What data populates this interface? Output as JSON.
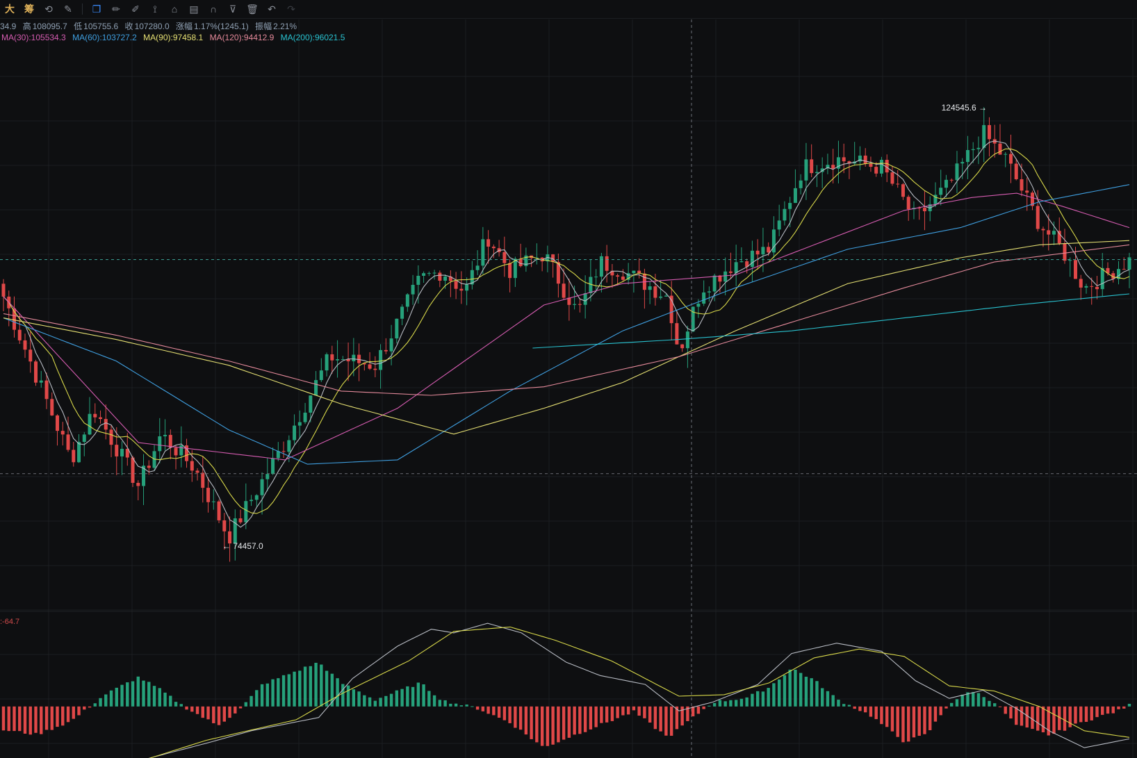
{
  "toolbar": {
    "tools": [
      {
        "name": "partial-left-tool",
        "glyph": "大"
      },
      {
        "name": "chip-distribution-tool",
        "glyph": "筹"
      },
      {
        "name": "refresh-chart-tool",
        "glyph": "⟲"
      },
      {
        "name": "pen-settings-tool",
        "glyph": "✎"
      },
      {
        "name": "copy-layout-tool",
        "glyph": "❐"
      },
      {
        "name": "ruler-tool",
        "glyph": "✏"
      },
      {
        "name": "brush-tool",
        "glyph": "✐"
      },
      {
        "name": "indicator-tool",
        "glyph": "⟟"
      },
      {
        "name": "lock-tool",
        "glyph": "⌂"
      },
      {
        "name": "note-tool",
        "glyph": "▤"
      },
      {
        "name": "magnet-tool",
        "glyph": "∩"
      },
      {
        "name": "filter-tool",
        "glyph": "⊽"
      },
      {
        "name": "delete-tool",
        "glyph": "🗑"
      },
      {
        "name": "undo-tool",
        "glyph": "↶"
      },
      {
        "name": "redo-tool",
        "glyph": "↷"
      }
    ]
  },
  "ohlc": {
    "open": "34.9",
    "high_label": "高",
    "high": "108095.7",
    "low_label": "低",
    "low": "105755.6",
    "close_label": "收",
    "close": "107280.0",
    "change_label": "涨幅",
    "change": "1.17%(1245.1)",
    "amp_label": "振幅",
    "amp": "2.21%"
  },
  "ma": [
    {
      "label": "MA(30):105534.3",
      "color": "#d65cb1"
    },
    {
      "label": "MA(60):103727.2",
      "color": "#3f9fe0"
    },
    {
      "label": "MA(90):97458.1",
      "color": "#e6e073"
    },
    {
      "label": "MA(120):94412.9",
      "color": "#e58a9b"
    },
    {
      "label": "MA(200):96021.5",
      "color": "#29c3d1"
    }
  ],
  "macd_label": ":-64.7",
  "colors": {
    "up": "#26a17b",
    "down": "#e04848",
    "grid": "#1b1d21",
    "crosshair": "#6b6f76",
    "ma5": "#b8bcc4",
    "ma10": "#d8d84a"
  },
  "chart_data": {
    "type": "candlestick",
    "y_range": [
      68000,
      131000
    ],
    "annotations": {
      "high": {
        "value": 124545.6,
        "text": "124545.6"
      },
      "low": {
        "value": 74457.0,
        "text": "74457.0"
      }
    },
    "crosshair_price": 107280.0,
    "lower_dashed_price": 82400,
    "anchors": [
      [
        103000,
        0
      ],
      [
        84000,
        0.06
      ],
      [
        90000,
        0.08
      ],
      [
        81000,
        0.12
      ],
      [
        87000,
        0.14
      ],
      [
        83000,
        0.17
      ],
      [
        75000,
        0.2
      ],
      [
        86000,
        0.25
      ],
      [
        96000,
        0.29
      ],
      [
        95000,
        0.33
      ],
      [
        105000,
        0.37
      ],
      [
        106000,
        0.39
      ],
      [
        103500,
        0.41
      ],
      [
        110000,
        0.43
      ],
      [
        106000,
        0.45
      ],
      [
        108000,
        0.48
      ],
      [
        101000,
        0.51
      ],
      [
        107000,
        0.53
      ],
      [
        106000,
        0.55
      ],
      [
        103000,
        0.59
      ],
      [
        96500,
        0.6
      ],
      [
        104000,
        0.62
      ],
      [
        107000,
        0.65
      ],
      [
        108500,
        0.68
      ],
      [
        118000,
        0.71
      ],
      [
        119000,
        0.74
      ],
      [
        118000,
        0.78
      ],
      [
        112000,
        0.81
      ],
      [
        116000,
        0.84
      ],
      [
        122000,
        0.87
      ],
      [
        119000,
        0.89
      ],
      [
        111500,
        0.92
      ],
      [
        108500,
        0.94
      ],
      [
        104000,
        0.96
      ],
      [
        107200,
        1
      ]
    ],
    "mas": [
      {
        "name": "MA(30)",
        "color": "#d65cb1",
        "values": [
          [
            0.0,
            103000
          ],
          [
            0.12,
            86000
          ],
          [
            0.25,
            84000
          ],
          [
            0.35,
            90000
          ],
          [
            0.48,
            102000
          ],
          [
            0.55,
            104500
          ],
          [
            0.65,
            105500
          ],
          [
            0.72,
            109000
          ],
          [
            0.8,
            113000
          ],
          [
            0.86,
            114500
          ],
          [
            0.9,
            115000
          ],
          [
            0.94,
            113500
          ],
          [
            1.0,
            111000
          ]
        ]
      },
      {
        "name": "MA(60)",
        "color": "#3f9fe0",
        "values": [
          [
            0.0,
            100500
          ],
          [
            0.1,
            95500
          ],
          [
            0.2,
            87500
          ],
          [
            0.27,
            83500
          ],
          [
            0.35,
            84000
          ],
          [
            0.45,
            92000
          ],
          [
            0.55,
            99000
          ],
          [
            0.65,
            104000
          ],
          [
            0.75,
            108500
          ],
          [
            0.85,
            111000
          ],
          [
            0.92,
            114000
          ],
          [
            1.0,
            116000
          ]
        ]
      },
      {
        "name": "MA(90)",
        "color": "#e6e073",
        "values": [
          [
            0.0,
            100500
          ],
          [
            0.1,
            98000
          ],
          [
            0.2,
            95000
          ],
          [
            0.3,
            90500
          ],
          [
            0.4,
            87000
          ],
          [
            0.48,
            90000
          ],
          [
            0.55,
            93000
          ],
          [
            0.65,
            99000
          ],
          [
            0.75,
            104500
          ],
          [
            0.85,
            107500
          ],
          [
            0.92,
            109000
          ],
          [
            1.0,
            109500
          ]
        ]
      },
      {
        "name": "MA(120)",
        "color": "#e58a9b",
        "values": [
          [
            0.0,
            101000
          ],
          [
            0.1,
            98500
          ],
          [
            0.2,
            95500
          ],
          [
            0.3,
            92000
          ],
          [
            0.38,
            91500
          ],
          [
            0.48,
            92500
          ],
          [
            0.6,
            96000
          ],
          [
            0.7,
            100000
          ],
          [
            0.8,
            104000
          ],
          [
            0.88,
            107000
          ],
          [
            1.0,
            109000
          ]
        ]
      },
      {
        "name": "MA(200)",
        "color": "#29c3d1",
        "values": [
          [
            0.47,
            97000
          ],
          [
            0.6,
            98000
          ],
          [
            0.7,
            99000
          ],
          [
            0.8,
            100500
          ],
          [
            0.9,
            102000
          ],
          [
            1.0,
            103300
          ]
        ]
      }
    ],
    "macd": {
      "range": [
        -700,
        1150
      ],
      "dif_anchors": [
        [
          0.0,
          -900
        ],
        [
          0.1,
          -820
        ],
        [
          0.18,
          -500
        ],
        [
          0.22,
          -330
        ],
        [
          0.28,
          -150
        ],
        [
          0.31,
          380
        ],
        [
          0.35,
          820
        ],
        [
          0.38,
          1050
        ],
        [
          0.4,
          1000
        ],
        [
          0.43,
          1130
        ],
        [
          0.46,
          1000
        ],
        [
          0.5,
          600
        ],
        [
          0.53,
          420
        ],
        [
          0.57,
          300
        ],
        [
          0.6,
          -60
        ],
        [
          0.63,
          60
        ],
        [
          0.67,
          300
        ],
        [
          0.7,
          720
        ],
        [
          0.74,
          860
        ],
        [
          0.78,
          750
        ],
        [
          0.81,
          350
        ],
        [
          0.84,
          110
        ],
        [
          0.87,
          220
        ],
        [
          0.9,
          -30
        ],
        [
          0.93,
          -340
        ],
        [
          0.96,
          -560
        ],
        [
          1.0,
          -440
        ]
      ],
      "dea_anchors": [
        [
          0.0,
          -900
        ],
        [
          0.12,
          -750
        ],
        [
          0.18,
          -460
        ],
        [
          0.26,
          -180
        ],
        [
          0.3,
          170
        ],
        [
          0.36,
          620
        ],
        [
          0.4,
          1020
        ],
        [
          0.45,
          1080
        ],
        [
          0.49,
          900
        ],
        [
          0.54,
          620
        ],
        [
          0.6,
          140
        ],
        [
          0.64,
          160
        ],
        [
          0.68,
          320
        ],
        [
          0.72,
          660
        ],
        [
          0.76,
          780
        ],
        [
          0.8,
          680
        ],
        [
          0.84,
          280
        ],
        [
          0.88,
          210
        ],
        [
          0.92,
          0
        ],
        [
          0.96,
          -330
        ],
        [
          1.0,
          -420
        ]
      ],
      "hist_anchors": [
        [
          0.0,
          -320
        ],
        [
          0.03,
          -380
        ],
        [
          0.06,
          -200
        ],
        [
          0.09,
          160
        ],
        [
          0.12,
          400
        ],
        [
          0.14,
          220
        ],
        [
          0.16,
          0
        ],
        [
          0.19,
          -260
        ],
        [
          0.21,
          -40
        ],
        [
          0.23,
          300
        ],
        [
          0.26,
          480
        ],
        [
          0.28,
          600
        ],
        [
          0.3,
          320
        ],
        [
          0.33,
          90
        ],
        [
          0.37,
          320
        ],
        [
          0.39,
          80
        ],
        [
          0.42,
          -20
        ],
        [
          0.45,
          -220
        ],
        [
          0.48,
          -560
        ],
        [
          0.5,
          -430
        ],
        [
          0.53,
          -250
        ],
        [
          0.56,
          -70
        ],
        [
          0.59,
          -420
        ],
        [
          0.61,
          -180
        ],
        [
          0.63,
          60
        ],
        [
          0.66,
          120
        ],
        [
          0.68,
          260
        ],
        [
          0.7,
          520
        ],
        [
          0.72,
          360
        ],
        [
          0.74,
          100
        ],
        [
          0.77,
          -120
        ],
        [
          0.8,
          -480
        ],
        [
          0.82,
          -380
        ],
        [
          0.84,
          40
        ],
        [
          0.86,
          220
        ],
        [
          0.88,
          60
        ],
        [
          0.9,
          -260
        ],
        [
          0.93,
          -390
        ],
        [
          0.96,
          -200
        ],
        [
          0.99,
          -60
        ],
        [
          1.0,
          20
        ]
      ]
    }
  }
}
